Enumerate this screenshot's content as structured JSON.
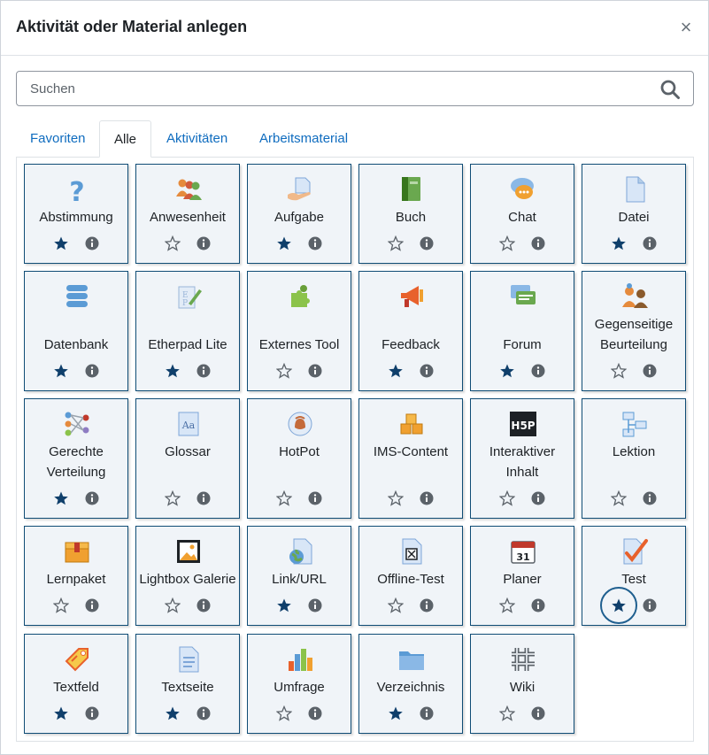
{
  "dialog": {
    "title": "Aktivität oder Material anlegen",
    "close": "×"
  },
  "search": {
    "placeholder": "Suchen",
    "value": ""
  },
  "tabs": [
    {
      "label": "Favoriten",
      "active": false
    },
    {
      "label": "Alle",
      "active": true
    },
    {
      "label": "Aktivitäten",
      "active": false
    },
    {
      "label": "Arbeitsmaterial",
      "active": false
    }
  ],
  "colors": {
    "accent": "#0f6cbf",
    "star": "#0f3f6b",
    "tile_bg": "#f0f4f8",
    "tile_border": "#0f4c75"
  },
  "tiles": [
    {
      "label": "Abstimmung",
      "icon": "question-icon",
      "favorite": true
    },
    {
      "label": "Anwesenheit",
      "icon": "people-icon",
      "favorite": false
    },
    {
      "label": "Aufgabe",
      "icon": "document-hand-icon",
      "favorite": true
    },
    {
      "label": "Buch",
      "icon": "book-icon",
      "favorite": false
    },
    {
      "label": "Chat",
      "icon": "chat-icon",
      "favorite": false
    },
    {
      "label": "Datei",
      "icon": "file-icon",
      "favorite": true
    },
    {
      "label": "Datenbank",
      "icon": "database-icon",
      "favorite": true
    },
    {
      "label": "Etherpad Lite",
      "icon": "etherpad-icon",
      "favorite": true
    },
    {
      "label": "Externes Tool",
      "icon": "puzzle-icon",
      "favorite": false
    },
    {
      "label": "Feedback",
      "icon": "megaphone-icon",
      "favorite": true
    },
    {
      "label": "Forum",
      "icon": "forum-icon",
      "favorite": true
    },
    {
      "label": "Gegenseitige Beurteilung",
      "icon": "peer-review-icon",
      "favorite": false
    },
    {
      "label": "Gerechte Verteilung",
      "icon": "distribution-icon",
      "favorite": true
    },
    {
      "label": "Glossar",
      "icon": "glossary-icon",
      "favorite": false
    },
    {
      "label": "HotPot",
      "icon": "hotpot-icon",
      "favorite": false
    },
    {
      "label": "IMS-Content",
      "icon": "boxes-icon",
      "favorite": false
    },
    {
      "label": "Interaktiver Inhalt",
      "icon": "h5p-icon",
      "favorite": false
    },
    {
      "label": "Lektion",
      "icon": "lesson-icon",
      "favorite": false
    },
    {
      "label": "Lernpaket",
      "icon": "package-icon",
      "favorite": false
    },
    {
      "label": "Lightbox Galerie",
      "icon": "gallery-icon",
      "favorite": false
    },
    {
      "label": "Link/URL",
      "icon": "link-globe-icon",
      "favorite": true
    },
    {
      "label": "Offline-Test",
      "icon": "offline-test-icon",
      "favorite": false
    },
    {
      "label": "Planer",
      "icon": "calendar-icon",
      "favorite": false
    },
    {
      "label": "Test",
      "icon": "checkmark-icon",
      "favorite": true
    },
    {
      "label": "Textfeld",
      "icon": "tag-icon",
      "favorite": true
    },
    {
      "label": "Textseite",
      "icon": "text-page-icon",
      "favorite": true
    },
    {
      "label": "Umfrage",
      "icon": "bar-chart-icon",
      "favorite": false
    },
    {
      "label": "Verzeichnis",
      "icon": "folder-icon",
      "favorite": true
    },
    {
      "label": "Wiki",
      "icon": "wiki-icon",
      "favorite": false
    }
  ]
}
